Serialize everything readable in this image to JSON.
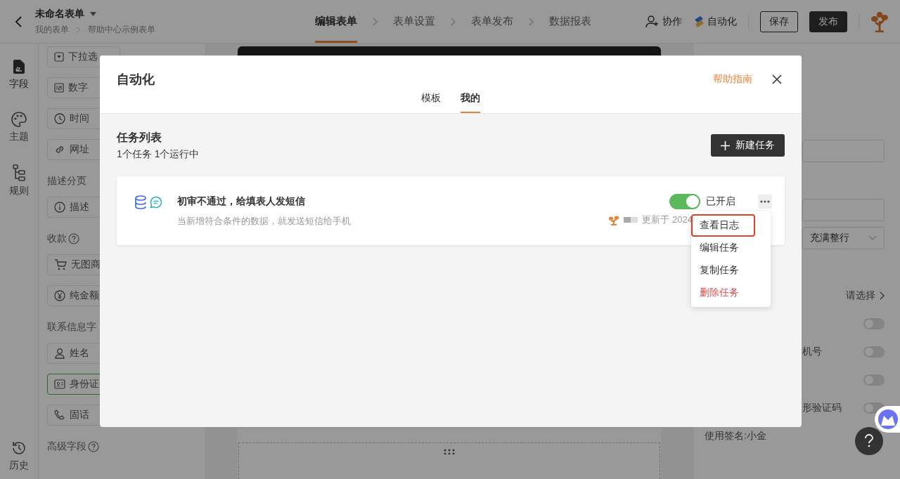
{
  "header": {
    "title": "未命名表单",
    "breadcrumb": [
      "我的表单",
      "帮助中心示例表单"
    ],
    "steps": [
      {
        "label": "编辑表单",
        "selected": true
      },
      {
        "label": "表单设置",
        "selected": false
      },
      {
        "label": "表单发布",
        "selected": false
      },
      {
        "label": "数据报表",
        "selected": false
      }
    ],
    "actions": [
      {
        "kind": "collab",
        "label": "协作"
      },
      {
        "kind": "automation",
        "label": "自动化"
      }
    ],
    "buttons": [
      {
        "kind": "outline",
        "label": "保存"
      },
      {
        "kind": "primary",
        "label": "发布"
      }
    ]
  },
  "rail": [
    {
      "label": "字段",
      "selected": true
    },
    {
      "label": "主题",
      "selected": false
    },
    {
      "label": "规则",
      "selected": false
    },
    {
      "label": "历史",
      "selected": false
    }
  ],
  "palette": [
    {
      "kind": "fields",
      "items": [
        {
          "label": "下拉选",
          "selected": false
        }
      ]
    },
    {
      "kind": "fields",
      "items": [
        {
          "label": "数字",
          "selected": false
        }
      ]
    },
    {
      "kind": "fields",
      "items": [
        {
          "label": "时间",
          "selected": false
        }
      ]
    },
    {
      "kind": "fields",
      "items": [
        {
          "label": "网址",
          "selected": false
        }
      ]
    },
    {
      "kind": "heading",
      "label": "描述分页"
    },
    {
      "kind": "fields",
      "items": [
        {
          "label": "描述",
          "selected": false
        }
      ]
    },
    {
      "kind": "heading",
      "label": "收款",
      "help": true
    },
    {
      "kind": "fields",
      "items": [
        {
          "label": "无图商",
          "selected": false
        }
      ]
    },
    {
      "kind": "fields",
      "items": [
        {
          "label": "纯金额",
          "selected": false
        }
      ]
    },
    {
      "kind": "heading",
      "label": "联系信息字"
    },
    {
      "kind": "fields",
      "items": [
        {
          "label": "姓名",
          "selected": false
        }
      ]
    },
    {
      "kind": "fields",
      "items": [
        {
          "label": "身份证",
          "selected": true
        }
      ]
    },
    {
      "kind": "fields",
      "items": [
        {
          "label": "固话",
          "selected": false
        }
      ]
    },
    {
      "kind": "heading",
      "label": "高级字段",
      "help": true
    }
  ],
  "settings": [
    {
      "kind": "input"
    },
    {
      "kind": "input"
    },
    {
      "kind": "select",
      "value": "充满整行"
    },
    {
      "kind": "link",
      "value": "请选择"
    },
    {
      "kind": "toggle",
      "on": false
    },
    {
      "kind": "toggle",
      "label": "机号",
      "on": false
    },
    {
      "kind": "toggle",
      "on": false
    },
    {
      "kind": "toggle",
      "label": "形验证码",
      "on": false
    },
    {
      "kind": "text",
      "value": "使用签名:小金"
    }
  ],
  "modal": {
    "title": "自动化",
    "help_link": "帮助指南",
    "tabs": [
      {
        "label": "模板",
        "selected": false
      },
      {
        "label": "我的",
        "selected": true
      }
    ],
    "list_title": "任务列表",
    "list_summary": "1个任务 1个运行中",
    "new_button": "新建任务",
    "tasks": [
      {
        "title": "初审不通过，给填表人发短信",
        "description": "当新增符合条件的数据，就发送短信给手机",
        "enabled": true,
        "status": "已开启",
        "updated": "更新于 2024",
        "menu": [
          {
            "kind": "normal",
            "label": "查看日志",
            "highlighted": true
          },
          {
            "kind": "normal",
            "label": "编辑任务",
            "highlighted": false
          },
          {
            "kind": "normal",
            "label": "复制任务",
            "highlighted": false
          },
          {
            "kind": "danger",
            "label": "删除任务",
            "highlighted": false
          }
        ]
      }
    ]
  }
}
